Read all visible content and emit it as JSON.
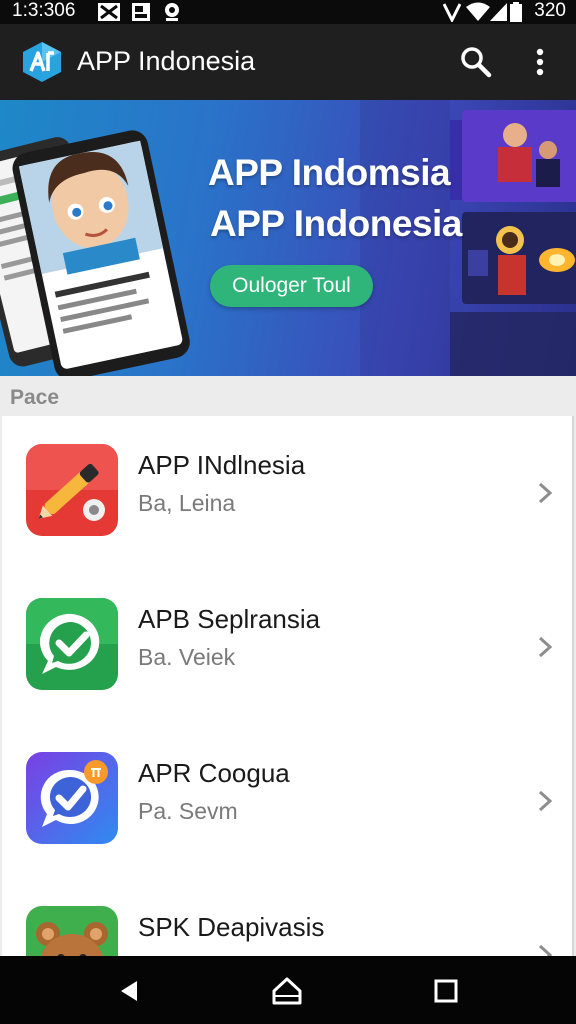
{
  "status_bar": {
    "time": "1:3:306",
    "battery_text": "320",
    "icons": [
      "mail-x-icon",
      "photo-icon",
      "location-icon",
      "vpn-icon",
      "wifi-icon",
      "signal-icon",
      "battery-icon"
    ]
  },
  "app_bar": {
    "title": "APP Indonesia",
    "logo_icon": "app-logo-icon",
    "actions": [
      "search-icon",
      "more-vert-icon"
    ]
  },
  "banner": {
    "headline_1": "APP Indomsia",
    "headline_2": "APP Indonesia",
    "cta_label": "Ouloger Toul",
    "cta_color": "#2fb57a"
  },
  "section": {
    "label": "Pace"
  },
  "apps": [
    {
      "title": "APP INdlnesia",
      "subtitle": "Ba, Leina",
      "icon": "pen-rocket-icon",
      "icon_color": "#e53935"
    },
    {
      "title": "APB Seplransia",
      "subtitle": "Ba. Veiek",
      "icon": "chat-check-icon",
      "icon_color": "#25a04d"
    },
    {
      "title": "APR Coogua",
      "subtitle": "Pa. Sevm",
      "icon": "chat-check-badge-icon",
      "icon_color": "#4a63e0"
    },
    {
      "title": "SPK Deapivasis",
      "subtitle": "",
      "icon": "bear-icon",
      "icon_color": "#3fae4c"
    }
  ],
  "nav_bar": {
    "buttons": [
      "back-icon",
      "home-icon",
      "recents-icon"
    ]
  }
}
